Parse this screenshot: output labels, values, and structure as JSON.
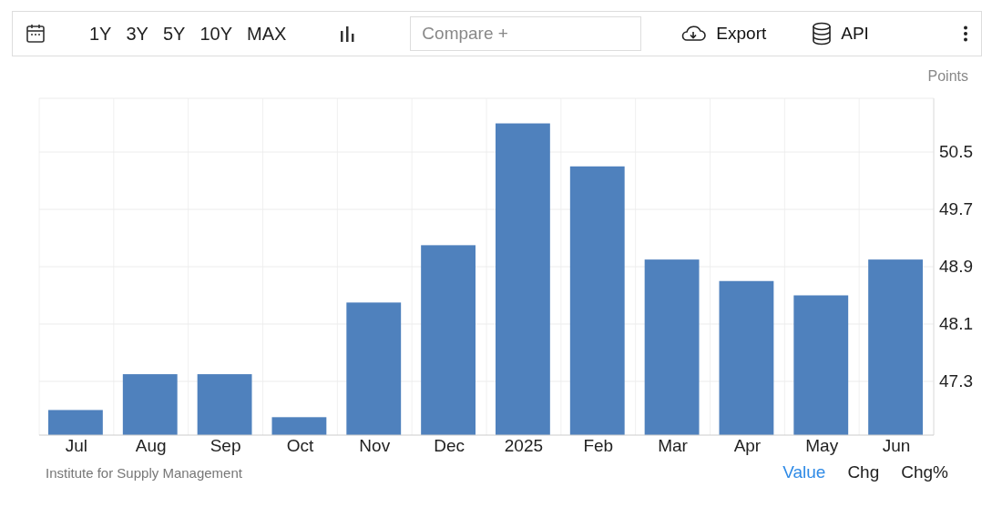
{
  "toolbar": {
    "ranges": [
      "1Y",
      "3Y",
      "5Y",
      "10Y",
      "MAX"
    ],
    "compare": {
      "placeholder": "Compare +"
    },
    "export": "Export",
    "api": "API"
  },
  "chart": {
    "unit": "Points",
    "chart_data": {
      "type": "bar",
      "categories": [
        "Jul",
        "Aug",
        "Sep",
        "Oct",
        "Nov",
        "Dec",
        "2025",
        "Feb",
        "Mar",
        "Apr",
        "May",
        "Jun"
      ],
      "grid": true,
      "series": [
        {
          "color": "#4f81bd",
          "values": [
            46.9,
            47.4,
            47.4,
            46.8,
            48.4,
            49.2,
            50.9,
            50.3,
            49.0,
            48.7,
            48.5,
            49.0
          ]
        }
      ],
      "ylim": [
        46.55,
        51.25
      ],
      "yticks": [
        47.3,
        48.1,
        48.9,
        49.7,
        50.5
      ]
    }
  },
  "footer": {
    "source": "Institute for Supply Management",
    "views": [
      {
        "label": "Value",
        "selected": true
      },
      {
        "label": "Chg",
        "selected": false
      },
      {
        "label": "Chg%",
        "selected": false
      }
    ]
  }
}
